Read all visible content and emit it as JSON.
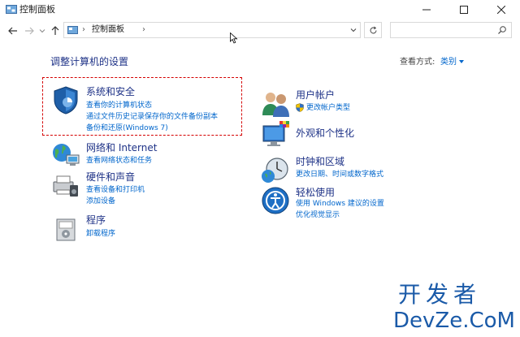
{
  "window": {
    "title": "控制面板",
    "minimize_glyph": "—",
    "maximize_glyph": "☐",
    "close_glyph": "✕"
  },
  "addressbar": {
    "separator": "›",
    "location": "控制面板",
    "trailing_separator": "›",
    "search_placeholder": ""
  },
  "content": {
    "heading": "调整计算机的设置",
    "view_by_label": "查看方式:",
    "view_by_value": "类别"
  },
  "categories": [
    {
      "icon": "system-security-icon",
      "title": "系统和安全",
      "links": [
        "查看你的计算机状态",
        "通过文件历史记录保存你的文件备份副本",
        "备份和还原(Windows 7)"
      ]
    },
    {
      "icon": "network-icon",
      "title": "网络和 Internet",
      "links": [
        "查看网络状态和任务"
      ]
    },
    {
      "icon": "hardware-sound-icon",
      "title": "硬件和声音",
      "links": [
        "查看设备和打印机",
        "添加设备"
      ]
    },
    {
      "icon": "programs-icon",
      "title": "程序",
      "links": [
        "卸载程序"
      ]
    },
    {
      "icon": "user-accounts-icon",
      "title": "用户帐户",
      "links": [
        "更改帐户类型"
      ]
    },
    {
      "icon": "appearance-icon",
      "title": "外观和个性化",
      "links": []
    },
    {
      "icon": "clock-region-icon",
      "title": "时钟和区域",
      "links": [
        "更改日期、时间或数字格式"
      ]
    },
    {
      "icon": "ease-of-access-icon",
      "title": "轻松使用",
      "links": [
        "使用 Windows 建议的设置",
        "优化视觉显示"
      ]
    }
  ],
  "watermark": {
    "line1": "开发者",
    "line2": "DevZe.CoM"
  },
  "colors": {
    "heading": "#1e3287",
    "link": "#0066cc",
    "highlight": "#d40000",
    "watermark": "#1a5aa8"
  }
}
